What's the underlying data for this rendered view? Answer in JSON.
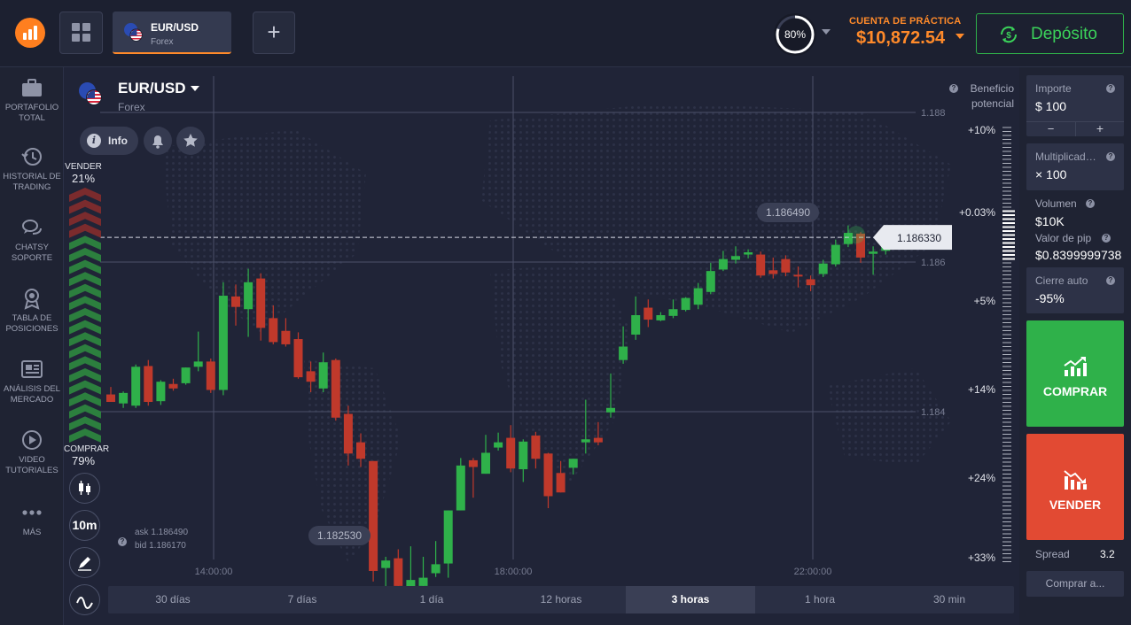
{
  "topbar": {
    "tab_symbol": "EUR/USD",
    "tab_category": "Forex",
    "add_tab_label": "+",
    "percent": "80%",
    "account_label": "CUENTA DE PRÁCTICA",
    "balance": "$10,872.54",
    "deposit_label": "Depósito"
  },
  "sidebar": {
    "items": [
      {
        "label": "PORTAFOLIO TOTAL",
        "icon": "briefcase-icon"
      },
      {
        "label": "HISTORIAL DE TRADING",
        "icon": "clock-history-icon"
      },
      {
        "label": "CHATSY SOPORTE",
        "icon": "chat-bubbles-icon"
      },
      {
        "label": "TABLA DE POSICIONES",
        "icon": "medal-icon"
      },
      {
        "label": "ANÁLISIS DEL MERCADO",
        "icon": "newspaper-icon"
      },
      {
        "label": "VIDEO TUTORIALES",
        "icon": "play-circle-icon"
      },
      {
        "label": "MÁS",
        "icon": "more-dots-icon"
      }
    ]
  },
  "chart": {
    "symbol": "EUR/USD",
    "category": "Forex",
    "info_label": "Info",
    "sell_label": "VENDER",
    "sell_pct": "21%",
    "buy_label": "COMPRAR",
    "buy_pct": "79%",
    "timeframe": "10m",
    "ask": "ask 1.186490",
    "bid": "bid 1.186170",
    "beneficio": "Beneficio potencial",
    "high_label": "1.186490",
    "low_label": "1.182530",
    "current_price": "1.186330",
    "price_ticks": [
      "1.188",
      "1.186",
      "1.184"
    ],
    "time_ticks": [
      "14:00:00",
      "18:00:00",
      "22:00:00"
    ],
    "profit_scale": [
      "+10%",
      "+0.03%",
      "+5%",
      "+14%",
      "+24%",
      "+33%"
    ]
  },
  "chart_data": {
    "type": "candlestick",
    "price_axis_ticks": [
      1.188,
      1.186,
      1.184
    ],
    "time_axis_ticks": [
      "14:00:00",
      "18:00:00",
      "22:00:00"
    ],
    "up_color": "#2fb14a",
    "down_color": "#c0392b",
    "candles": [
      {
        "o": 1.18423,
        "h": 1.18433,
        "c": 1.18413,
        "l": 1.18413
      },
      {
        "o": 1.18411,
        "h": 1.18427,
        "c": 1.18425,
        "l": 1.18405
      },
      {
        "o": 1.18408,
        "h": 1.18463,
        "c": 1.1846,
        "l": 1.18405
      },
      {
        "o": 1.18461,
        "h": 1.18469,
        "c": 1.18413,
        "l": 1.18408
      },
      {
        "o": 1.18414,
        "h": 1.18442,
        "c": 1.1844,
        "l": 1.18409
      },
      {
        "o": 1.18437,
        "h": 1.18444,
        "c": 1.18431,
        "l": 1.18428
      },
      {
        "o": 1.18438,
        "h": 1.18458,
        "c": 1.18459,
        "l": 1.18436
      },
      {
        "o": 1.1846,
        "h": 1.18507,
        "c": 1.18467,
        "l": 1.18454
      },
      {
        "o": 1.18467,
        "h": 1.18471,
        "c": 1.18429,
        "l": 1.18425
      },
      {
        "o": 1.18429,
        "h": 1.18573,
        "c": 1.18555,
        "l": 1.18422
      },
      {
        "o": 1.18554,
        "h": 1.1857,
        "c": 1.1854,
        "l": 1.18515
      },
      {
        "o": 1.18537,
        "h": 1.18591,
        "c": 1.18573,
        "l": 1.185
      },
      {
        "o": 1.18578,
        "h": 1.18585,
        "c": 1.18512,
        "l": 1.18495
      },
      {
        "o": 1.18525,
        "h": 1.18542,
        "c": 1.18493,
        "l": 1.1849
      },
      {
        "o": 1.18508,
        "h": 1.18525,
        "c": 1.1849,
        "l": 1.18487
      },
      {
        "o": 1.18497,
        "h": 1.18506,
        "c": 1.18446,
        "l": 1.18444
      },
      {
        "o": 1.18454,
        "h": 1.18467,
        "c": 1.1844,
        "l": 1.18426
      },
      {
        "o": 1.18431,
        "h": 1.18479,
        "c": 1.18466,
        "l": 1.18426
      },
      {
        "o": 1.18469,
        "h": 1.18471,
        "c": 1.18392,
        "l": 1.18388
      },
      {
        "o": 1.18397,
        "h": 1.18408,
        "c": 1.18344,
        "l": 1.18328
      },
      {
        "o": 1.18359,
        "h": 1.18371,
        "c": 1.18337,
        "l": 1.18326
      },
      {
        "o": 1.18334,
        "h": 1.18323,
        "c": 1.18187,
        "l": 1.18173
      },
      {
        "o": 1.18191,
        "h": 1.18206,
        "c": 1.18201,
        "l": 1.18163
      },
      {
        "o": 1.18204,
        "h": 1.18216,
        "c": 1.18167,
        "l": 1.18162
      },
      {
        "o": 1.18156,
        "h": 1.1822,
        "c": 1.18175,
        "l": 1.18136
      },
      {
        "o": 1.18167,
        "h": 1.18206,
        "c": 1.18178,
        "l": 1.18155
      },
      {
        "o": 1.18184,
        "h": 1.18227,
        "c": 1.18196,
        "l": 1.18179
      },
      {
        "o": 1.18197,
        "h": 1.18266,
        "c": 1.18268,
        "l": 1.18178
      },
      {
        "o": 1.18268,
        "h": 1.18338,
        "c": 1.18328,
        "l": 1.18268
      },
      {
        "o": 1.18335,
        "h": 1.18338,
        "c": 1.18326,
        "l": 1.18285
      },
      {
        "o": 1.18317,
        "h": 1.18369,
        "c": 1.18345,
        "l": 1.18318
      },
      {
        "o": 1.18352,
        "h": 1.18372,
        "c": 1.18359,
        "l": 1.18348
      },
      {
        "o": 1.18365,
        "h": 1.18382,
        "c": 1.18324,
        "l": 1.18319
      },
      {
        "o": 1.18323,
        "h": 1.18363,
        "c": 1.1836,
        "l": 1.18306
      },
      {
        "o": 1.18368,
        "h": 1.18373,
        "c": 1.18337,
        "l": 1.18324
      },
      {
        "o": 1.18344,
        "h": 1.18345,
        "c": 1.18287,
        "l": 1.18271
      },
      {
        "o": 1.18318,
        "h": 1.18334,
        "c": 1.18292,
        "l": 1.18294
      },
      {
        "o": 1.18325,
        "h": 1.18334,
        "c": 1.18337,
        "l": 1.18316
      },
      {
        "o": 1.18359,
        "h": 1.18416,
        "c": 1.18363,
        "l": 1.18344
      },
      {
        "o": 1.18365,
        "h": 1.18386,
        "c": 1.18359,
        "l": 1.18355
      },
      {
        "o": 1.18399,
        "h": 1.18451,
        "c": 1.18405,
        "l": 1.18392
      },
      {
        "o": 1.18469,
        "h": 1.18514,
        "c": 1.18487,
        "l": 1.18464
      },
      {
        "o": 1.18503,
        "h": 1.18554,
        "c": 1.18529,
        "l": 1.18496
      },
      {
        "o": 1.18539,
        "h": 1.1855,
        "c": 1.18523,
        "l": 1.18513
      },
      {
        "o": 1.18522,
        "h": 1.18533,
        "c": 1.18529,
        "l": 1.18521
      },
      {
        "o": 1.18528,
        "h": 1.1855,
        "c": 1.18537,
        "l": 1.18525
      },
      {
        "o": 1.18536,
        "h": 1.18553,
        "c": 1.18552,
        "l": 1.18534
      },
      {
        "o": 1.18543,
        "h": 1.18572,
        "c": 1.18565,
        "l": 1.18537
      },
      {
        "o": 1.1856,
        "h": 1.18599,
        "c": 1.18588,
        "l": 1.18557
      },
      {
        "o": 1.1859,
        "h": 1.18615,
        "c": 1.18604,
        "l": 1.18588
      },
      {
        "o": 1.18603,
        "h": 1.18621,
        "c": 1.18608,
        "l": 1.18598
      },
      {
        "o": 1.1861,
        "h": 1.18617,
        "c": 1.18613,
        "l": 1.18605
      },
      {
        "o": 1.1861,
        "h": 1.18614,
        "c": 1.18582,
        "l": 1.18579
      },
      {
        "o": 1.18589,
        "h": 1.18606,
        "c": 1.18584,
        "l": 1.18578
      },
      {
        "o": 1.18604,
        "h": 1.18609,
        "c": 1.18586,
        "l": 1.18581
      },
      {
        "o": 1.18583,
        "h": 1.18594,
        "c": 1.18582,
        "l": 1.18566
      },
      {
        "o": 1.18577,
        "h": 1.18582,
        "c": 1.18569,
        "l": 1.18561
      },
      {
        "o": 1.18584,
        "h": 1.18603,
        "c": 1.18598,
        "l": 1.1858
      },
      {
        "o": 1.18597,
        "h": 1.1863,
        "c": 1.18623,
        "l": 1.18594
      },
      {
        "o": 1.18624,
        "h": 1.18649,
        "c": 1.18639,
        "l": 1.1862
      },
      {
        "o": 1.18638,
        "h": 1.1864,
        "c": 1.18606,
        "l": 1.18599
      },
      {
        "o": 1.18611,
        "h": 1.18621,
        "c": 1.18614,
        "l": 1.18583
      },
      {
        "o": 1.18615,
        "h": 1.1864,
        "c": 1.18633,
        "l": 1.1861
      }
    ]
  },
  "periods": [
    "30 días",
    "7 días",
    "1 día",
    "12 horas",
    "3 horas",
    "1 hora",
    "30 min"
  ],
  "active_period": "3 horas",
  "trade": {
    "amount_label": "Importe",
    "amount_value": "$  100",
    "minus": "−",
    "plus": "+",
    "multiplier_label": "Multiplicad…",
    "multiplier_value": "× 100",
    "volume_label": "Volumen",
    "volume_value": "$10K",
    "pip_label": "Valor de pip",
    "pip_value": "$0.8399999738",
    "autoclose_label": "Cierre auto",
    "autoclose_value": "-95%",
    "buy_label": "COMPRAR",
    "sell_label": "VENDER",
    "spread_label": "Spread",
    "spread_value": "3.2",
    "buy_at_label": "Comprar a..."
  }
}
